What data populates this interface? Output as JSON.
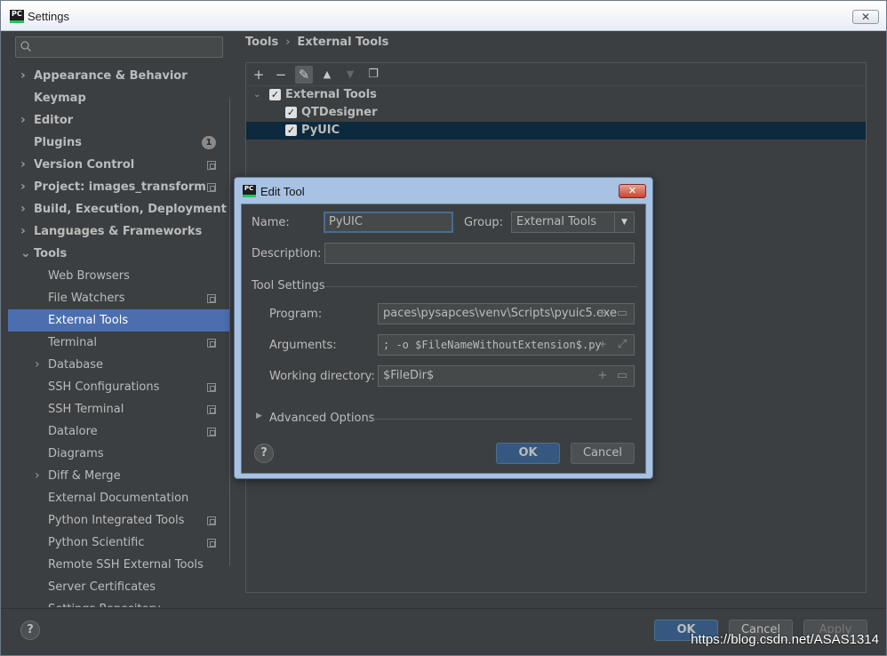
{
  "window": {
    "title": "Settings",
    "app_icon_text": "PC",
    "close_symbol": "✕"
  },
  "search": {
    "placeholder": ""
  },
  "sidebar": {
    "items": [
      {
        "label": "Appearance & Behavior",
        "expandable": true,
        "expanded": false
      },
      {
        "label": "Keymap"
      },
      {
        "label": "Editor",
        "expandable": true,
        "expanded": false
      },
      {
        "label": "Plugins",
        "badge": "1"
      },
      {
        "label": "Version Control",
        "expandable": true,
        "copy_icon": true
      },
      {
        "label": "Project: images_transform",
        "expandable": true,
        "copy_icon": true
      },
      {
        "label": "Build, Execution, Deployment",
        "expandable": true
      },
      {
        "label": "Languages & Frameworks",
        "expandable": true
      },
      {
        "label": "Tools",
        "expandable": true,
        "expanded": true
      }
    ],
    "tools_children": [
      {
        "label": "Web Browsers"
      },
      {
        "label": "File Watchers",
        "copy_icon": true
      },
      {
        "label": "External Tools",
        "selected": true
      },
      {
        "label": "Terminal",
        "copy_icon": true
      },
      {
        "label": "Database",
        "expandable": true
      },
      {
        "label": "SSH Configurations",
        "copy_icon": true
      },
      {
        "label": "SSH Terminal",
        "copy_icon": true
      },
      {
        "label": "Datalore",
        "copy_icon": true
      },
      {
        "label": "Diagrams"
      },
      {
        "label": "Diff & Merge",
        "expandable": true
      },
      {
        "label": "External Documentation"
      },
      {
        "label": "Python Integrated Tools",
        "copy_icon": true
      },
      {
        "label": "Python Scientific",
        "copy_icon": true
      },
      {
        "label": "Remote SSH External Tools"
      },
      {
        "label": "Server Certificates"
      },
      {
        "label": "Settings Repository"
      }
    ]
  },
  "breadcrumb": {
    "parent": "Tools",
    "separator": "›",
    "current": "External Tools"
  },
  "toolbar": {
    "add": "+",
    "remove": "−",
    "edit": "✎",
    "up": "▲",
    "down": "▼",
    "copy": "❐"
  },
  "tools_tree": {
    "group": {
      "label": "External Tools",
      "checked": true,
      "check": "✓",
      "arrow": "⌄"
    },
    "items": [
      {
        "label": "QTDesigner",
        "check": "✓"
      },
      {
        "label": "PyUIC",
        "check": "✓",
        "selected": true
      }
    ]
  },
  "dialog": {
    "title": "Edit Tool",
    "app_icon_text": "PC",
    "close_symbol": "✕",
    "name_label": "Name:",
    "name_value": "PyUIC",
    "group_label": "Group:",
    "group_value": "External Tools",
    "description_label": "Description:",
    "description_value": "",
    "tool_settings_label": "Tool Settings",
    "program_label": "Program:",
    "program_value": "paces\\pysapces\\venv\\Scripts\\pyuic5.exe",
    "arguments_label": "Arguments:",
    "arguments_value": "; -o $FileNameWithoutExtension$.py",
    "workdir_label": "Working directory:",
    "workdir_value": "$FileDir$",
    "advanced_label": "Advanced Options",
    "help_symbol": "?",
    "ok_label": "OK",
    "cancel_label": "Cancel"
  },
  "footer": {
    "help_symbol": "?",
    "ok_label": "OK",
    "cancel_label": "Cancel",
    "apply_label": "Apply",
    "watermark": "https://blog.csdn.net/ASAS1314"
  },
  "colors": {
    "selection": "#4b6eaf",
    "tree_selection": "#0d293e",
    "primary_button": "#365880",
    "background": "#3c3f41"
  }
}
